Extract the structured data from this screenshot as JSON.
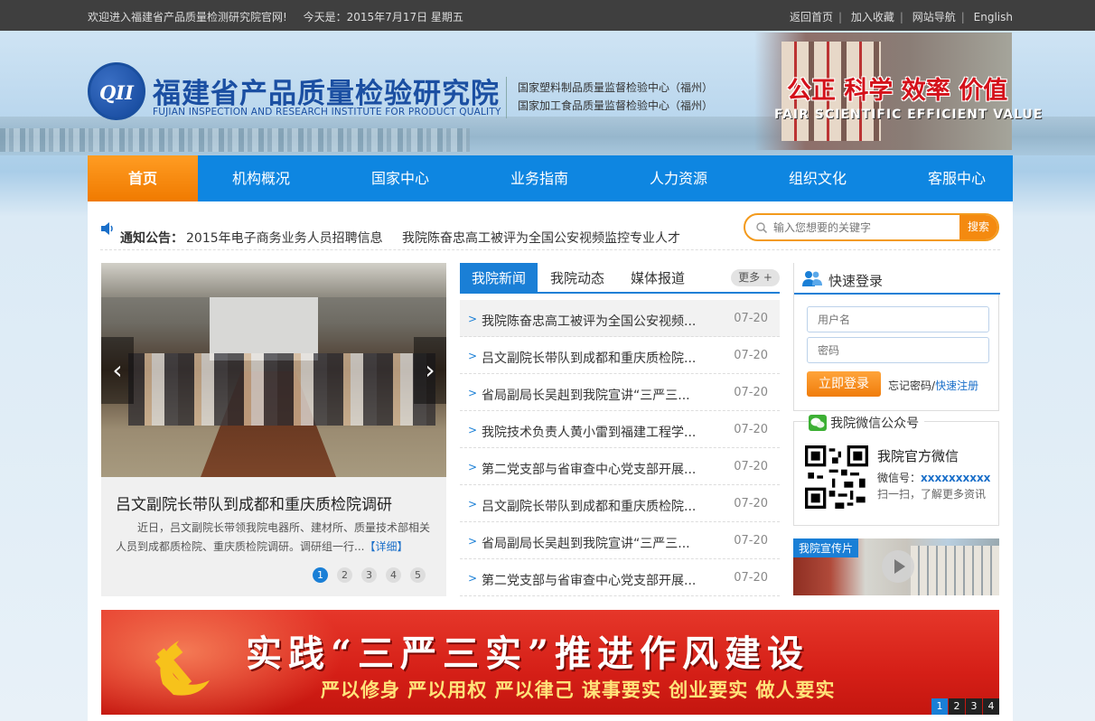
{
  "topbar": {
    "welcome": "欢迎进入福建省产品质量检测研究院官网!",
    "today": "今天是：2015年7月17日 星期五",
    "links": [
      "返回首页",
      "加入收藏",
      "网站导航",
      "English"
    ]
  },
  "header": {
    "logo_mark": "QII",
    "title_cn": "福建省产品质量检验研究院",
    "title_en": "FUJIAN INSPECTION AND RESEARCH INSTITUTE FOR PRODUCT QUALITY",
    "center1": "国家塑料制品质量监督检验中心（福州）",
    "center2": "国家加工食品质量监督检验中心（福州）",
    "slogan_cn": "公正 科学 效率 价值",
    "slogan_en": "FAIR  SCIENTIFIC  EFFICIENT  VALUE"
  },
  "nav": {
    "items": [
      "首页",
      "机构概况",
      "国家中心",
      "业务指南",
      "人力资源",
      "组织文化",
      "客服中心"
    ],
    "active": "首页"
  },
  "notice": {
    "label": "通知公告：",
    "items": [
      "2015年电子商务业务人员招聘信息",
      "我院陈奋忠高工被评为全国公安视频监控专业人才"
    ]
  },
  "search": {
    "placeholder": "输入您想要的关键字",
    "button": "搜索"
  },
  "slider": {
    "caption": "吕文副院长带队到成都和重庆质检院调研",
    "desc": "近日，吕文副院长带领我院电器所、建材所、质量技术部相关人员到成都质检院、重庆质检院调研。调研组一行...",
    "detail": "【详细】",
    "pages": [
      "1",
      "2",
      "3",
      "4",
      "5"
    ],
    "current_page": "1",
    "prev_icon": "‹",
    "next_icon": "›"
  },
  "news": {
    "tabs": [
      "我院新闻",
      "我院动态",
      "媒体报道"
    ],
    "active_tab": "我院新闻",
    "more": "更多 +",
    "items": [
      {
        "title": "我院陈奋忠高工被评为全国公安视频...",
        "date": "07-20"
      },
      {
        "title": "吕文副院长带队到成都和重庆质检院...",
        "date": "07-20"
      },
      {
        "title": "省局副局长吴赳到我院宣讲“三严三...",
        "date": "07-20"
      },
      {
        "title": "我院技术负责人黄小雷到福建工程学...",
        "date": "07-20"
      },
      {
        "title": "第二党支部与省审查中心党支部开展...",
        "date": "07-20"
      },
      {
        "title": "吕文副院长带队到成都和重庆质检院...",
        "date": "07-20"
      },
      {
        "title": "省局副局长吴赳到我院宣讲“三严三...",
        "date": "07-20"
      },
      {
        "title": "第二党支部与省审查中心党支部开展...",
        "date": "07-20"
      }
    ]
  },
  "login": {
    "title": "快速登录",
    "username_placeholder": "用户名",
    "password_placeholder": "密码",
    "button": "立即登录",
    "forgot": "忘记密码",
    "sep": "/",
    "register": "快速注册"
  },
  "wechat": {
    "title": "我院微信公众号",
    "line1": "我院官方微信",
    "id_label": "微信号：",
    "id_value": "xxxxxxxxxx",
    "line3": "扫一扫，了解更多资讯"
  },
  "video": {
    "label": "我院宣传片"
  },
  "banner": {
    "headline": "实践“三严三实”推进作风建设",
    "subline": "严以修身 严以用权 严以律己 谋事要实 创业要实 做人要实",
    "pages": [
      "1",
      "2",
      "3",
      "4"
    ],
    "current_page": "1"
  },
  "colors": {
    "nav_blue": "#0e86e1",
    "accent_orange": "#f48a10",
    "banner_red": "#d51f17",
    "link_blue": "#1a6fc9"
  }
}
